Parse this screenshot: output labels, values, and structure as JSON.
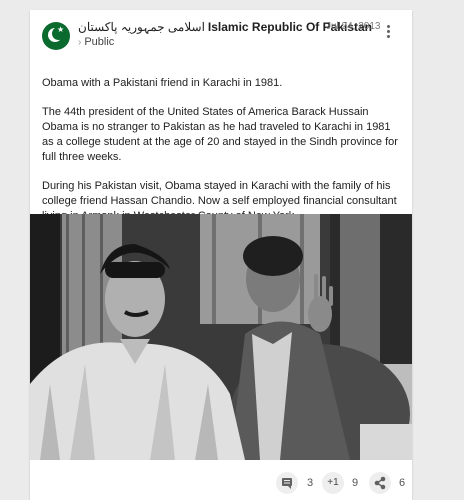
{
  "post": {
    "author_urdu": "اسلامی جمہوریہ پاکستان",
    "author": "Islamic Republic Of Pakistan",
    "visibility": "Public",
    "date": "Jul 24, 2013",
    "paragraphs": [
      "Obama with a Pakistani friend in Karachi in 1981.",
      "The 44th president of the United States of America Barack Hussain Obama is no stranger to Pakistan as he had traveled to Karachi in 1981 as a college student at the age of 20 and stayed in the Sindh province for full three weeks.",
      "During his Pakistan visit, Obama stayed in Karachi with the family of his college friend Hassan Chandio. Now a self employed financial consultant living in Armonk in Westchester County of New York."
    ]
  },
  "actions": {
    "comments_count": "3",
    "plus_one_label": "+1",
    "plus_one_count": "9",
    "shares_count": "6"
  },
  "icons": {
    "avatar": "pakistan-flag-icon",
    "more": "more-vert-icon",
    "comment": "comment-icon",
    "share": "share-icon",
    "chevron": "chevron-right-icon"
  },
  "colors": {
    "page_bg": "#ebebeb",
    "card_bg": "#ffffff",
    "text": "#212121",
    "muted": "#777777",
    "avatar_green": "#0b6b2f"
  }
}
